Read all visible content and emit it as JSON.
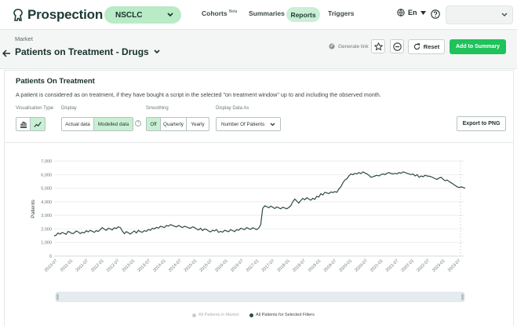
{
  "app": {
    "name": "Prospection Ai"
  },
  "nav": {
    "indication": "NSCLC",
    "cohorts": "Cohorts",
    "cohorts_badge": "Beta",
    "summaries": "Summaries",
    "reports": "Reports",
    "triggers": "Triggers",
    "language": "En"
  },
  "header": {
    "breadcrumb": "Market",
    "title": "Patients on Treatment - Drugs",
    "generate_link": "Generate link",
    "reset": "Reset",
    "add_to_summary": "Add to Summary"
  },
  "card": {
    "title": "Patients On Treatment",
    "description": "A patient is considered as on treatment, if they have bought a script in the selected \"on treatment window\" up to and including the observed month.",
    "visualisation_type_label": "Visualisation Type",
    "display_label": "Display",
    "display_options": [
      "Actual data",
      "Modelled data"
    ],
    "display_selected": "Modelled data",
    "smoothing_label": "Smoothing",
    "smoothing_options": [
      "Off",
      "Quarterly",
      "Yearly"
    ],
    "smoothing_selected": "Off",
    "display_as_label": "Display Data As",
    "display_as_value": "Number Of Patients",
    "export": "Export to PNG"
  },
  "legend": {
    "market": "All Patients in Market",
    "selected": "All Patients for Selected Filters",
    "market_color": "#c9cfcd",
    "selected_color": "#2e4a47"
  },
  "chart_data": {
    "type": "line",
    "ylabel": "Patients",
    "ylim": [
      0,
      7000
    ],
    "yticks": [
      "0",
      "1,000",
      "2,000",
      "3,000",
      "4,000",
      "5,000",
      "6,000",
      "7,000"
    ],
    "xticks": [
      "2010-07",
      "2011-01",
      "2011-07",
      "2012-01",
      "2012-07",
      "2013-01",
      "2013-07",
      "2014-01",
      "2014-07",
      "2015-01",
      "2015-07",
      "2016-01",
      "2016-07",
      "2017-01",
      "2017-07",
      "2018-01",
      "2018-07",
      "2019-01",
      "2019-07",
      "2020-01",
      "2020-07",
      "2021-01",
      "2021-07",
      "2022-01",
      "2022-07",
      "2023-01",
      "2023-07"
    ],
    "series": [
      {
        "name": "All Patients for Selected Filters",
        "color": "#2e4a47",
        "values": [
          1480,
          1550,
          1700,
          1620,
          1740,
          1680,
          1600,
          1820,
          1750,
          1650,
          1700,
          1850,
          1780,
          1660,
          1750,
          1700,
          1870,
          1780,
          1900,
          1830,
          1750,
          1880,
          1810,
          1950,
          2100,
          1980,
          1900,
          2050,
          2000,
          1930,
          2080,
          2030,
          2150,
          2100,
          1850,
          1650,
          1800,
          1720,
          1620,
          1750,
          1850,
          1700,
          1900,
          1800,
          1760,
          1880,
          1820,
          1960,
          1900,
          2050,
          2000,
          2120,
          2060,
          2200,
          2150,
          2100,
          2250,
          2200,
          2320,
          2260,
          2200,
          2150,
          2250,
          2180,
          2100,
          2200,
          2150,
          2080,
          2050,
          2150,
          2100,
          2000,
          1920,
          2050,
          1880,
          2000,
          1950,
          1850,
          1780,
          1900,
          1850,
          1950,
          1750,
          1820,
          1760,
          1900,
          1850,
          1800,
          1950,
          1880,
          1800,
          1950,
          1900,
          2050,
          2000,
          1950,
          2100,
          2030,
          1960,
          2080,
          2020,
          1950,
          2060,
          2300,
          3500,
          3700,
          3650,
          3560,
          3680,
          3600,
          3500,
          3620,
          3550,
          3480,
          3600,
          3540,
          3480,
          3580,
          3700,
          4000,
          4200,
          4050,
          3900,
          4100,
          4250,
          4150,
          4300,
          4200,
          4120,
          4250,
          4180,
          4400,
          4350,
          4600,
          4500,
          4700,
          4650,
          4600,
          4720,
          4680,
          4750,
          4700,
          4950,
          5100,
          5400,
          5600,
          5700,
          5900,
          6050,
          6000,
          6100,
          6050,
          6150,
          6080,
          6200,
          6120,
          6050,
          5950,
          5800,
          5850,
          5900,
          5950,
          5900,
          6000,
          6050,
          6000,
          6100,
          6150,
          6080,
          6050,
          6100,
          6050,
          6150,
          6100,
          6200,
          6150,
          6100,
          6050,
          6000,
          6050,
          5900,
          6000,
          5800,
          5900,
          5850,
          5950,
          5900,
          5880,
          5850,
          5780,
          5700,
          5650,
          5750,
          5800,
          5650,
          5550,
          5600,
          5480,
          5400,
          5300,
          5200,
          5100,
          5050,
          5100,
          5050,
          5000
        ]
      }
    ]
  }
}
